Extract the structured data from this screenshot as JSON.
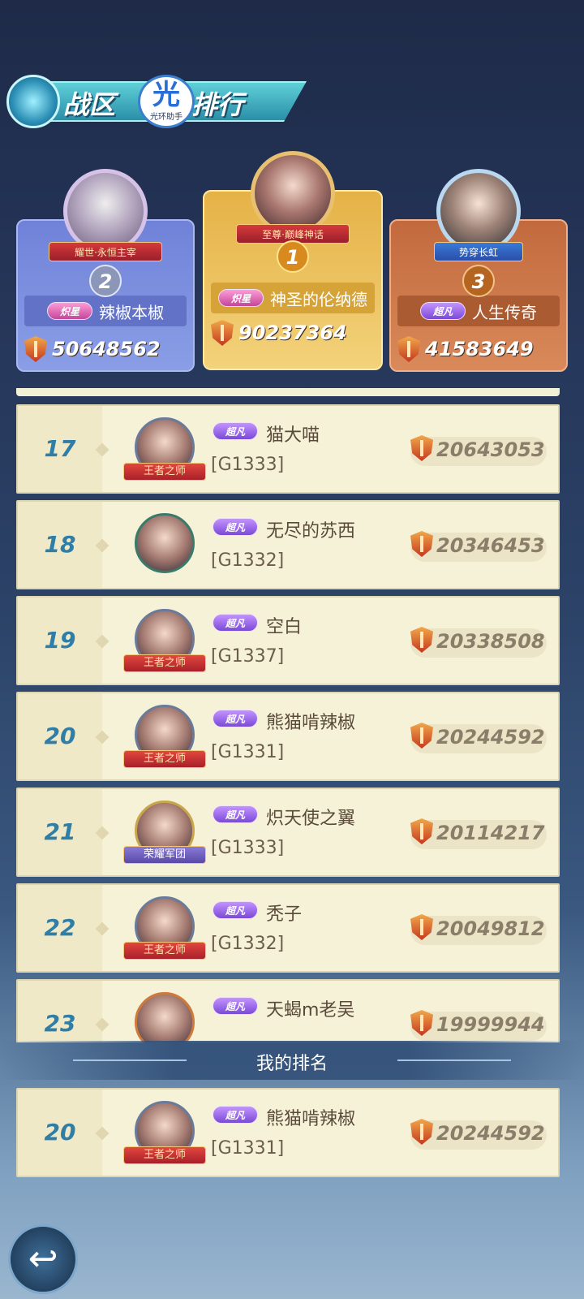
{
  "header": {
    "title_left": "战区",
    "title_right": "排行",
    "watermark_glyph": "光",
    "watermark_text": "光环助手"
  },
  "podium": [
    {
      "rank": "2",
      "title": "耀世·永恒主宰",
      "tier": "炽星",
      "name": "辣椒本椒",
      "score": "50648562"
    },
    {
      "rank": "1",
      "title": "至尊·巅峰神话",
      "tier": "炽星",
      "name": "神圣的伦纳德",
      "score": "90237364"
    },
    {
      "rank": "3",
      "title": "势穿长虹",
      "tier": "超凡",
      "name": "人生传奇",
      "score": "41583649"
    }
  ],
  "rows": [
    {
      "rank": "17",
      "plate": "王者之师",
      "tier": "超凡",
      "name": "猫大喵",
      "server": "[G1333]",
      "score": "20643053"
    },
    {
      "rank": "18",
      "plate": "",
      "tier": "超凡",
      "name": "无尽的苏西",
      "server": "[G1332]",
      "score": "20346453"
    },
    {
      "rank": "19",
      "plate": "王者之师",
      "tier": "超凡",
      "name": "空白",
      "server": "[G1337]",
      "score": "20338508"
    },
    {
      "rank": "20",
      "plate": "王者之师",
      "tier": "超凡",
      "name": "熊猫啃辣椒",
      "server": "[G1331]",
      "score": "20244592"
    },
    {
      "rank": "21",
      "plate": "荣耀军团",
      "tier": "超凡",
      "name": "炽天使之翼",
      "server": "[G1333]",
      "score": "20114217"
    },
    {
      "rank": "22",
      "plate": "王者之师",
      "tier": "超凡",
      "name": "秃子",
      "server": "[G1332]",
      "score": "20049812"
    },
    {
      "rank": "23",
      "plate": "",
      "tier": "超凡",
      "name": "天蝎m老吴",
      "server": "",
      "score": "19999944"
    }
  ],
  "my_rank": {
    "label": "我的排名",
    "rank": "20",
    "plate": "王者之师",
    "tier": "超凡",
    "name": "熊猫啃辣椒",
    "server": "[G1331]",
    "score": "20244592"
  },
  "back_icon": "↩"
}
